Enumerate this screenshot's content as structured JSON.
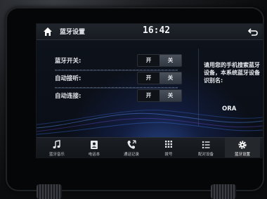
{
  "header": {
    "title": "蓝牙设置",
    "clock": "16:42"
  },
  "settings": [
    {
      "label": "蓝牙开关:",
      "on": "开",
      "off": "关"
    },
    {
      "label": "自动接听:",
      "on": "开",
      "off": "关"
    },
    {
      "label": "自动连接:",
      "on": "开",
      "off": "关"
    }
  ],
  "info": {
    "text": "请用您的手机搜索蓝牙设备，本系统蓝牙设备识别名:",
    "device_name": "ORA"
  },
  "tabs": [
    {
      "label": "蓝牙音乐",
      "icon": "music-note-icon"
    },
    {
      "label": "电话本",
      "icon": "contacts-icon"
    },
    {
      "label": "通话记录",
      "icon": "call-log-icon"
    },
    {
      "label": "拨号",
      "icon": "dialpad-icon"
    },
    {
      "label": "配对设备",
      "icon": "paired-devices-icon"
    },
    {
      "label": "蓝牙设置",
      "icon": "settings-gear-icon"
    }
  ],
  "active_tab": "蓝牙设置",
  "colors": {
    "accent": "#4a78e0",
    "background": "#0b0f17"
  }
}
